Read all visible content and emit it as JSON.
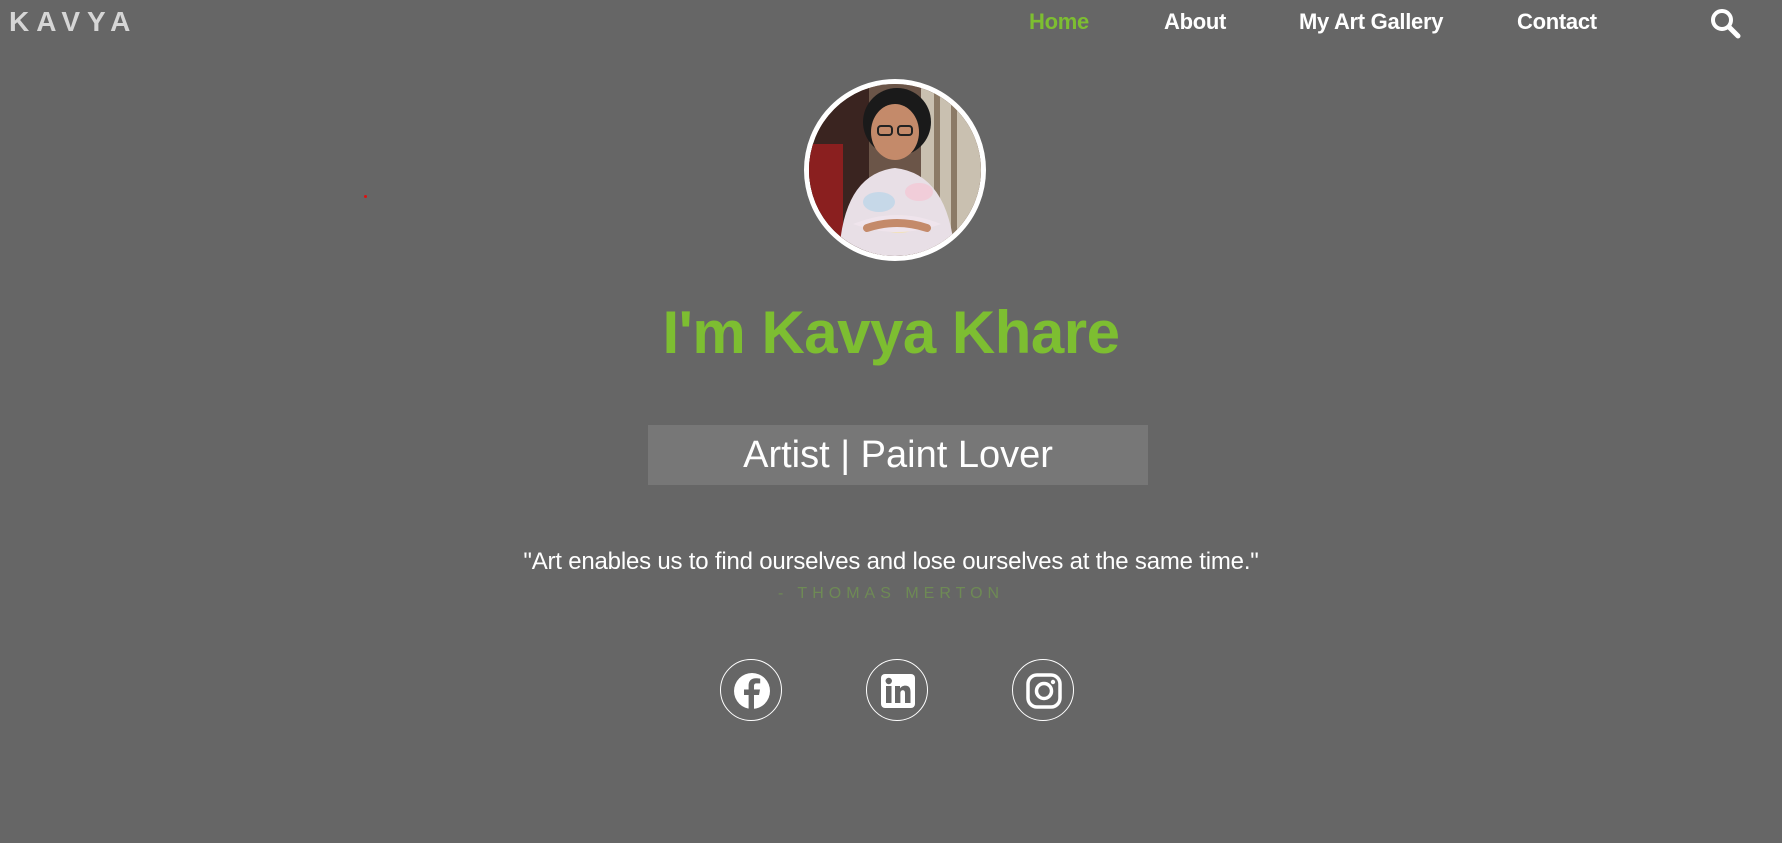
{
  "brand": "KAVYA",
  "nav": {
    "items": [
      {
        "label": "Home",
        "active": true
      },
      {
        "label": "About",
        "active": false
      },
      {
        "label": "My Art Gallery",
        "active": false
      },
      {
        "label": "Contact",
        "active": false
      }
    ],
    "search_icon": "search-icon"
  },
  "hero": {
    "avatar_icon": "profile-photo",
    "heading": "I'm Kavya Khare",
    "tagline": "Artist | Paint Lover",
    "quote": "\"Art enables us to find ourselves and lose ourselves at the same time.\"",
    "quote_author": "- THOMAS MERTON"
  },
  "social": [
    {
      "icon": "facebook-icon"
    },
    {
      "icon": "linkedin-icon"
    },
    {
      "icon": "instagram-icon"
    }
  ],
  "colors": {
    "background": "#666666",
    "accent": "#7dbe31",
    "tagline_box": "#777777",
    "author": "#6e8a55"
  }
}
